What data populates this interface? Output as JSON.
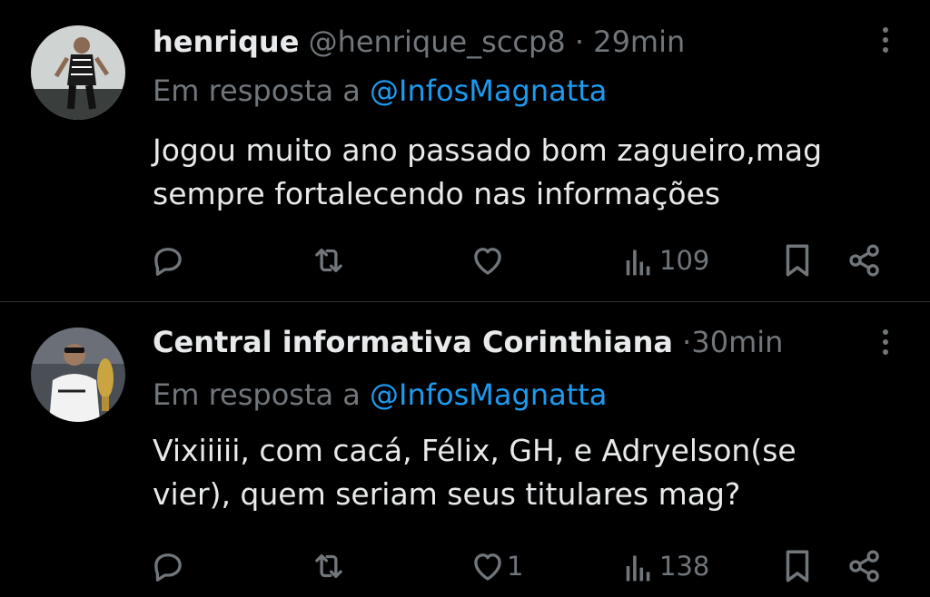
{
  "tweets": [
    {
      "display_name": "henrique",
      "handle": "@henrique_sccp8",
      "separator": "·",
      "time": "29min",
      "reply_prefix": "Em resposta a",
      "reply_to": "@InfosMagnatta",
      "text_line1": "Jogou muito ano passado bom zagueiro,mag",
      "text_line2": "sempre fortalecendo nas informações",
      "likes": "",
      "views": "109"
    },
    {
      "display_name": "Central informativa Corinthiana",
      "handle": "",
      "separator": "·",
      "time": "30min",
      "reply_prefix": "Em resposta a",
      "reply_to": "@InfosMagnatta",
      "text_line1": "Vixiiiii, com cacá, Félix, GH, e Adryelson(se",
      "text_line2": "vier), quem seriam seus titulares mag?",
      "likes": "1",
      "views": "138"
    }
  ],
  "icons": [
    "reply-icon",
    "retweet-icon",
    "like-icon",
    "views-icon",
    "bookmark-icon",
    "share-icon",
    "more-icon"
  ],
  "colors": {
    "background": "#000000",
    "text": "#e7e9ea",
    "muted": "#71767b",
    "link": "#1d9bf0",
    "divider": "#2f3336"
  }
}
